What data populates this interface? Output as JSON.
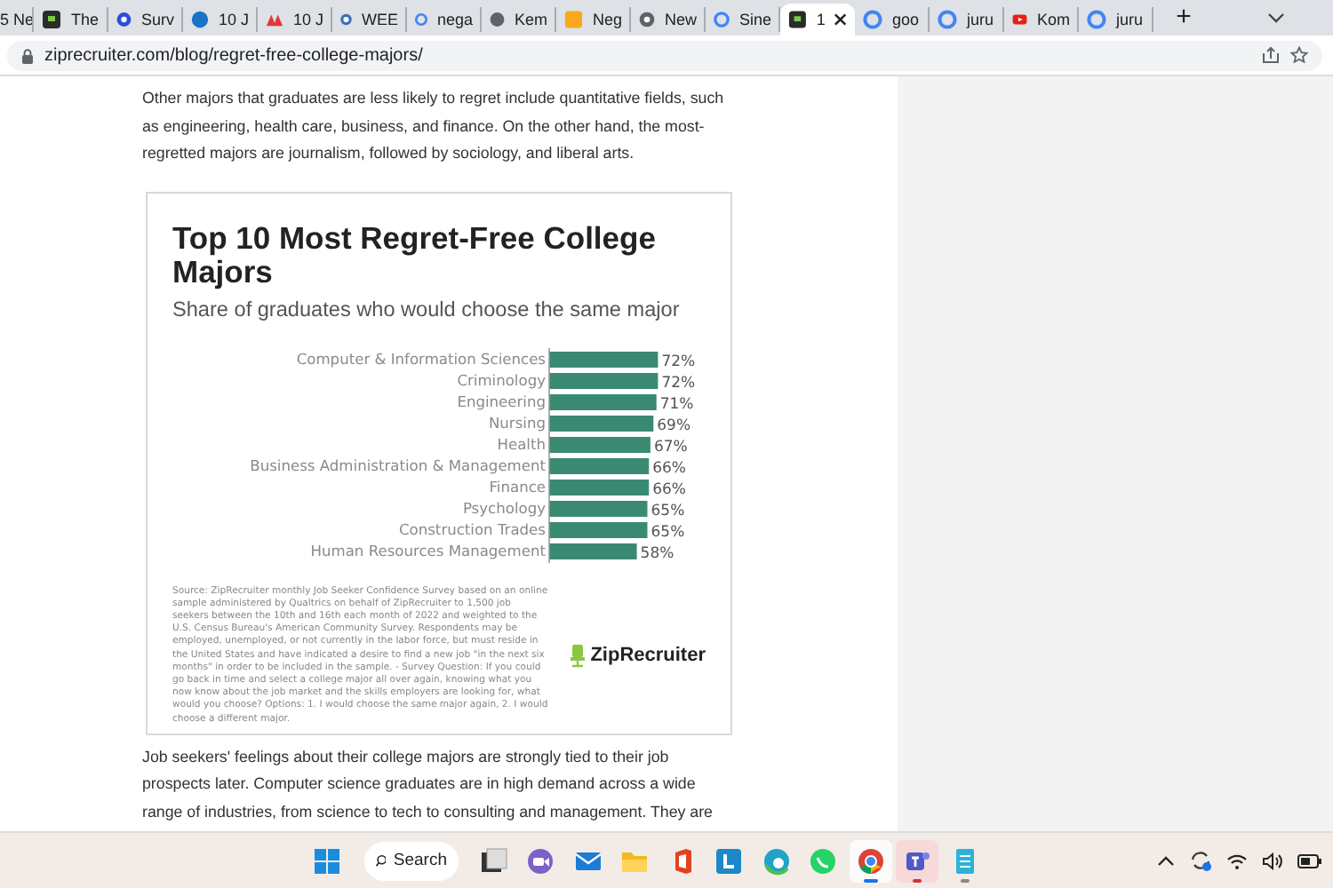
{
  "browser": {
    "tabs": [
      {
        "title": "5 Ne",
        "selected": false
      },
      {
        "title": "The",
        "selected": false
      },
      {
        "title": "Surv",
        "selected": false
      },
      {
        "title": "10 J",
        "selected": false
      },
      {
        "title": "10 J",
        "selected": false
      },
      {
        "title": "WEE",
        "selected": false
      },
      {
        "title": "nega",
        "selected": false
      },
      {
        "title": "Kem",
        "selected": false
      },
      {
        "title": "Neg",
        "selected": false
      },
      {
        "title": "New",
        "selected": false
      },
      {
        "title": "Sine",
        "selected": false
      },
      {
        "title": "1",
        "selected": true
      },
      {
        "title": "goo",
        "selected": false
      },
      {
        "title": "juru",
        "selected": false
      },
      {
        "title": "Kom",
        "selected": false
      },
      {
        "title": "juru",
        "selected": false
      }
    ],
    "new_tab": "+",
    "address": "ziprecruiter.com/blog/regret-free-college-majors/"
  },
  "article": {
    "paragraph_1": "Other majors that graduates are less likely to regret include quantitative fields, such as engineering, health care, business, and finance. On the other hand, the most-regretted majors are journalism, followed by sociology, and liberal arts.",
    "figure": {
      "title": "Top 10 Most Regret-Free College Majors",
      "subtitle": "Share of graduates who would choose the same major",
      "chart_data": {
        "type": "bar",
        "orientation": "horizontal",
        "categories": [
          "Computer & Information Sciences",
          "Criminology",
          "Engineering",
          "Nursing",
          "Health",
          "Business Administration & Management",
          "Finance",
          "Psychology",
          "Construction Trades",
          "Human Resources Management"
        ],
        "series": [
          {
            "color": "#3a8a73",
            "values": [
              72,
              72,
              71,
              69,
              67,
              66,
              66,
              65,
              65,
              58
            ],
            "value_labels": [
              "72%",
              "72%",
              "71%",
              "69%",
              "67%",
              "66%",
              "66%",
              "65%",
              "65%",
              "58%"
            ]
          }
        ]
      },
      "source": "Source: ZipRecruiter monthly Job Seeker Confidence Survey based on an online sample administered by Qualtrics on behalf of ZipRecruiter to 1,500 job seekers between the 10th and 16th each month of 2022 and weighted to the U.S. Census Bureau's American Community Survey. Respondents may be employed, unemployed, or not currently in the labor force, but must reside in the United States and have indicated a desire to find a new job \"in the next six months\" in order to be included in the sample. - Survey Question: If you could go back in time and select a college major all over again, knowing what you now know about the job market and the skills employers are looking for, what would you choose? Options: 1. I would choose the same major again, 2. I would choose a different major.",
      "logo": "ZipRecruiter"
    },
    "paragraph_2": "Job seekers' feelings about their college majors are strongly tied to their job prospects later. Computer science graduates are in high demand across a wide range of industries, from science to tech to consulting and management. They are"
  },
  "taskbar": {
    "search": "Search",
    "apps": [
      {
        "selected": false,
        "running": false,
        "attention": false
      },
      {
        "selected": false,
        "running": false,
        "attention": false
      },
      {
        "selected": false,
        "running": false,
        "attention": false
      },
      {
        "selected": false,
        "running": false,
        "attention": false
      },
      {
        "selected": false,
        "running": false,
        "attention": false
      },
      {
        "selected": false,
        "running": false,
        "attention": false
      },
      {
        "selected": false,
        "running": false,
        "attention": false
      },
      {
        "selected": false,
        "running": false,
        "attention": false
      },
      {
        "selected": true,
        "running": true,
        "attention": false
      },
      {
        "selected": false,
        "running": true,
        "attention": true
      },
      {
        "selected": false,
        "running": true,
        "attention": false
      }
    ]
  }
}
